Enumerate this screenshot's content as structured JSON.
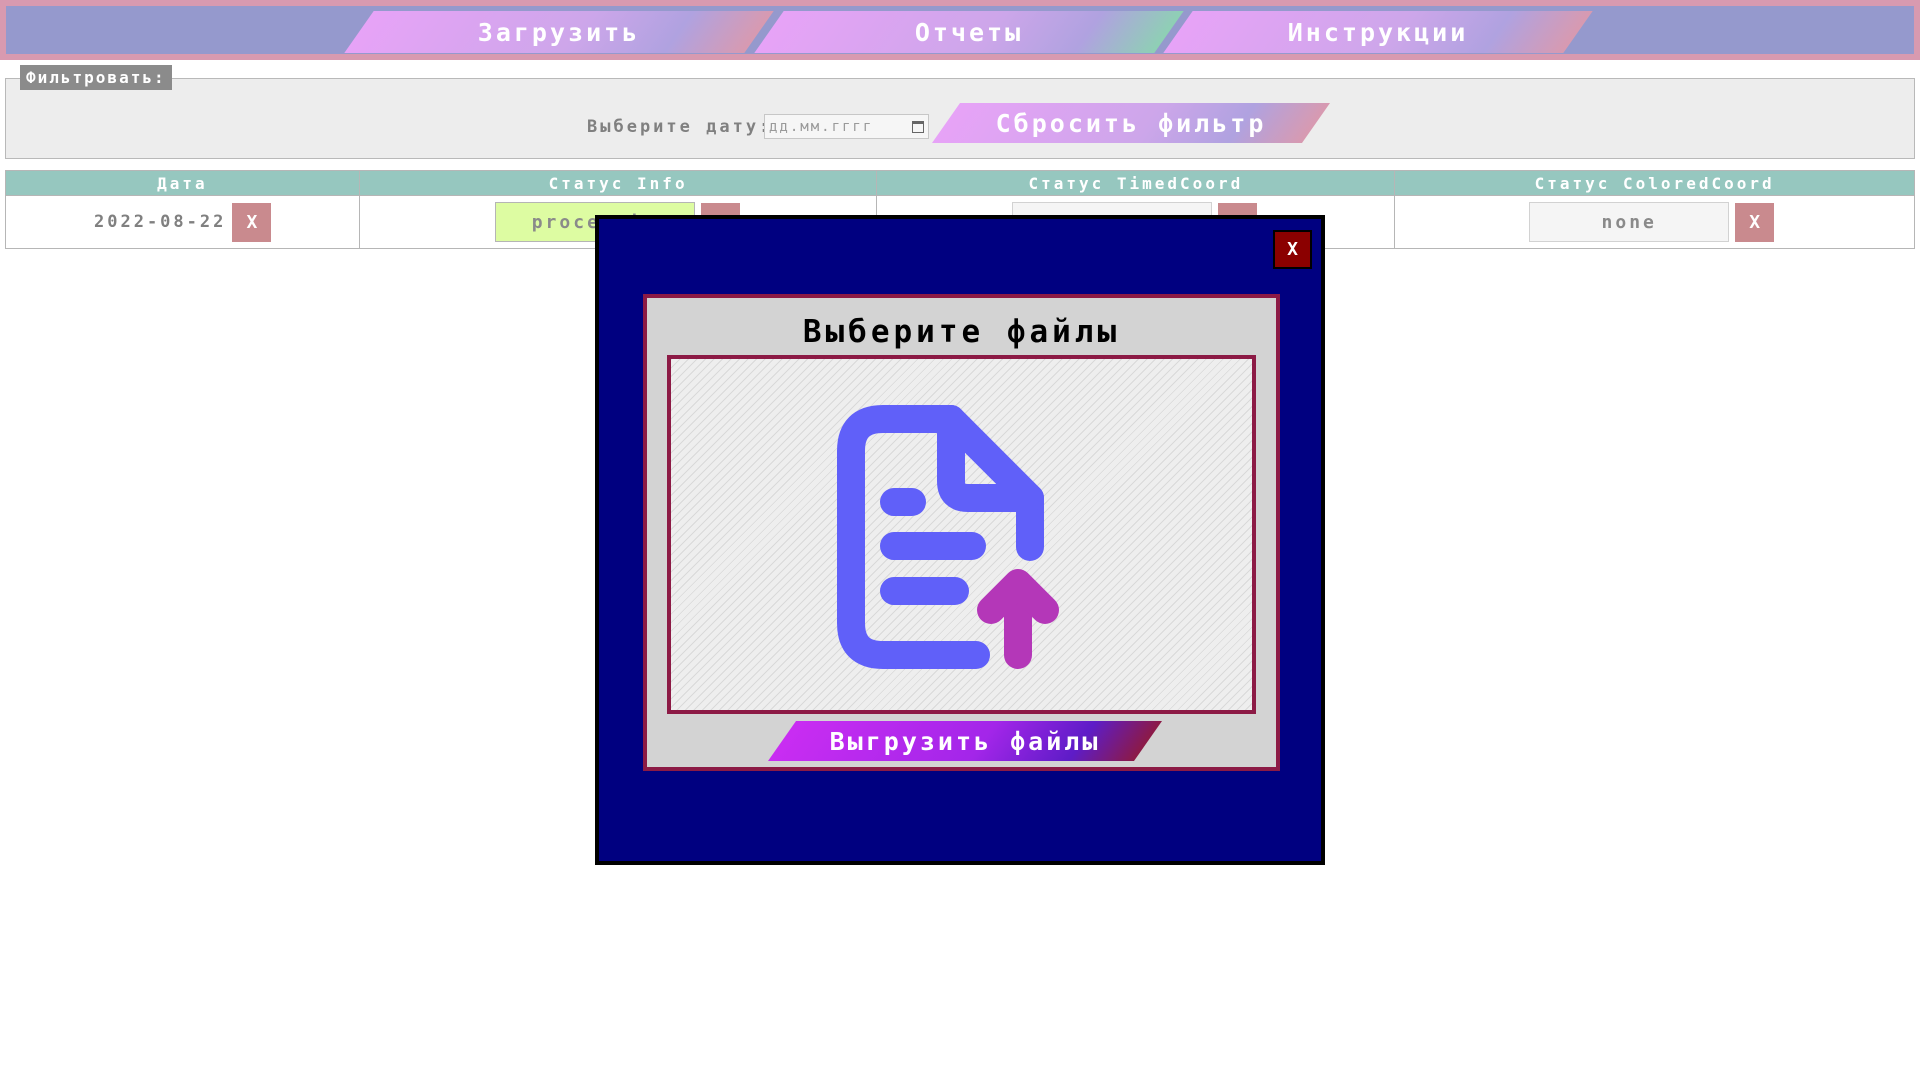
{
  "nav": {
    "items": [
      {
        "label": "Загрузить"
      },
      {
        "label": "Отчеты"
      },
      {
        "label": "Инструкции"
      }
    ]
  },
  "filter": {
    "legend": "Фильтровать:",
    "date_label": "Выберите дату:",
    "date_placeholder": "дд.мм.гггг",
    "reset_label": "Сбросить фильтр"
  },
  "table": {
    "headers": [
      "Дата",
      "Статус Info",
      "Статус TimedCoord",
      "Статус ColoredCoord"
    ],
    "rows": [
      {
        "date": "2022-08-22",
        "delete_label": "X",
        "info_status": "processing",
        "info_delete_label": "X",
        "timed_status": "",
        "timed_delete_label": "X",
        "colored_status": "none",
        "colored_delete_label": "X"
      }
    ]
  },
  "modal": {
    "close_label": "X",
    "title": "Выберите файлы",
    "upload_label": "Выгрузить файлы",
    "icon": "file-upload-icon"
  },
  "colors": {
    "nav_bg": "#9599cd",
    "nav_border": "#d89ab0",
    "header_bg": "#96c7bf",
    "modal_bg": "#000080",
    "panel_border": "#8c1a45",
    "processing_bg": "#ddfca2",
    "icon_file": "#6060f9",
    "icon_arrow": "#b437b8"
  }
}
